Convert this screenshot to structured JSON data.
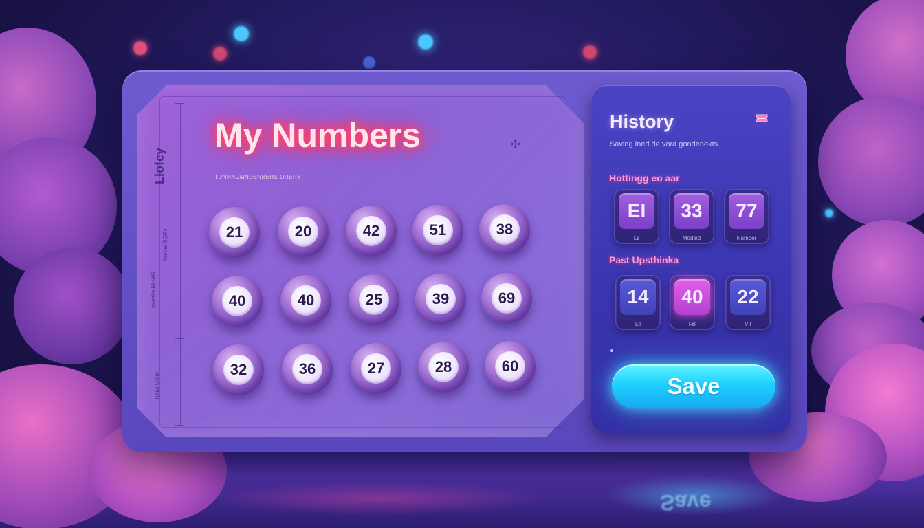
{
  "main": {
    "title": "My Numbers",
    "subtitle": "TUNNNUMNDSNBERS ORERY",
    "vertical_labels": [
      "Llofcy",
      "divislisiMuAR",
      "Northe SQRy",
      "Tuuui Qoko"
    ],
    "balls": [
      [
        "21",
        "20",
        "42",
        "51",
        "38"
      ],
      [
        "40",
        "40",
        "25",
        "39",
        "69"
      ],
      [
        "32",
        "36",
        "27",
        "28",
        "60"
      ]
    ]
  },
  "history": {
    "title": "History",
    "description": "Saving lned de vora gondenekts.",
    "icon": "ticket-icon",
    "hot_label": "Hottingg eo aar",
    "hot_chips": [
      {
        "value": "EI",
        "caption": "Ls"
      },
      {
        "value": "33",
        "caption": "Modaid"
      },
      {
        "value": "77",
        "caption": "Number"
      }
    ],
    "past_label": "Past Upsthinka",
    "past_chips": [
      {
        "value": "14",
        "caption": "Lll"
      },
      {
        "value": "40",
        "caption": "FB"
      },
      {
        "value": "22",
        "caption": "VII"
      }
    ],
    "save_label": "Save"
  },
  "colors": {
    "title_glow": "#ff3366",
    "save_button": "#1fd0ff",
    "panel": "#4b44c4",
    "ball": "#a978d8"
  }
}
